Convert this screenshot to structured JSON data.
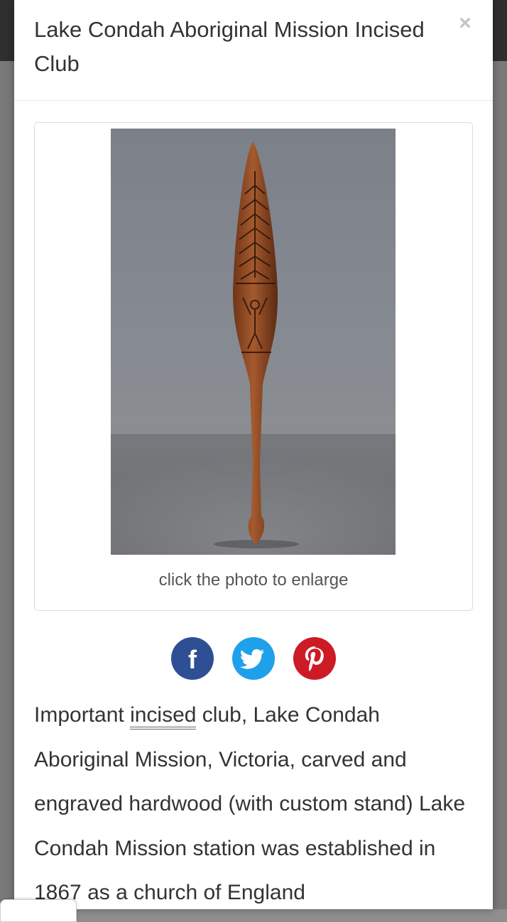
{
  "modal": {
    "title": "Lake Condah Aboriginal Mission Incised Club",
    "close_label": "×",
    "photo_caption": "click the photo to enlarge",
    "description_parts": {
      "before_link": "Important ",
      "link_text": "incised",
      "after_link": " club, Lake Condah Aboriginal Mission, Victoria, carved and engraved hardwood (with custom stand) Lake Condah Mission station was established in 1867 as a church of England"
    }
  },
  "social": {
    "facebook_glyph": "f",
    "icons": [
      "facebook-icon",
      "twitter-icon",
      "pinterest-icon"
    ]
  },
  "colors": {
    "facebook": "#2e4f93",
    "twitter": "#1ea1e8",
    "pinterest": "#cd1b25",
    "text": "#333333"
  }
}
